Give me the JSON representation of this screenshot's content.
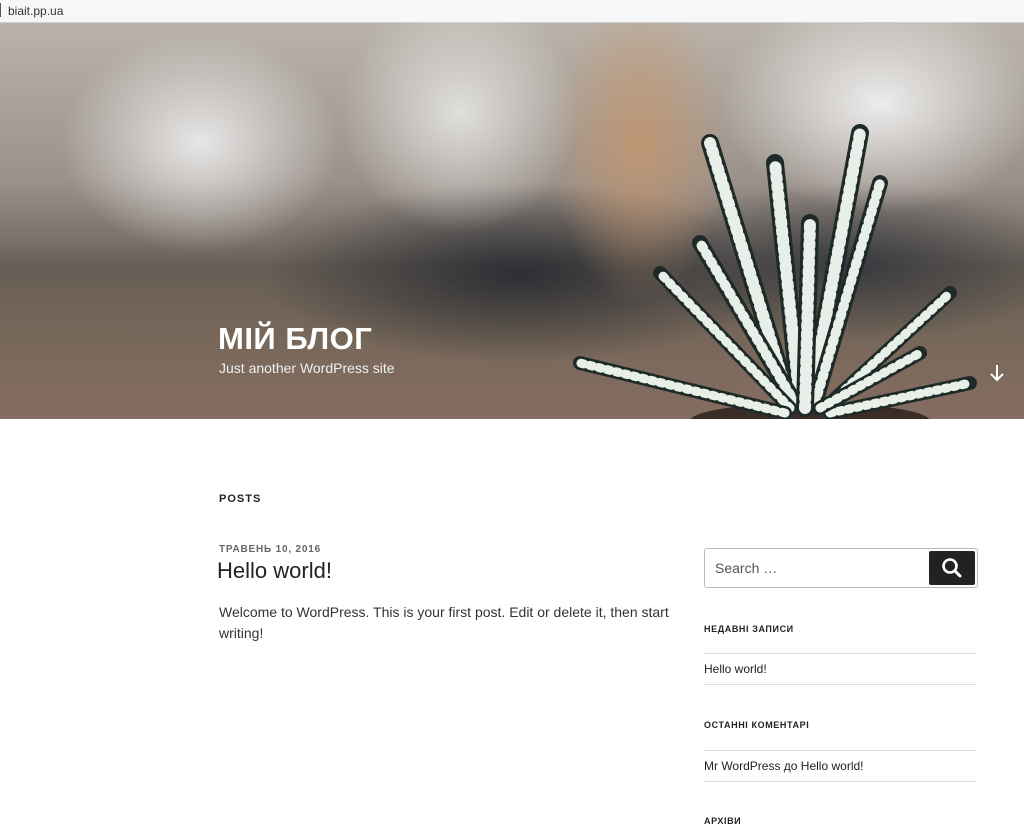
{
  "browser": {
    "url": "biait.pp.ua"
  },
  "header": {
    "title": "МІЙ БЛОГ",
    "description": "Just another WordPress site",
    "scroll_icon": "arrow-down-icon"
  },
  "main": {
    "section_heading": "POSTS",
    "post": {
      "date": "ТРАВЕНЬ 10, 2016",
      "title": "Hello world!",
      "excerpt": "Welcome to WordPress. This is your first post. Edit or delete it, then start writing!"
    }
  },
  "sidebar": {
    "search": {
      "placeholder": "Search …",
      "icon": "search-icon"
    },
    "recent_posts": {
      "title": "НЕДАВНІ ЗАПИСИ",
      "items": [
        "Hello world!"
      ]
    },
    "recent_comments": {
      "title": "ОСТАННІ КОМЕНТАРІ",
      "items": [
        {
          "author": "Mr WordPress",
          "connector": " до ",
          "post": "Hello world!"
        }
      ]
    },
    "archives": {
      "title": "АРХІВИ"
    }
  },
  "colors": {
    "button_bg": "#222222",
    "text": "#333333",
    "divider": "#dddddd"
  }
}
